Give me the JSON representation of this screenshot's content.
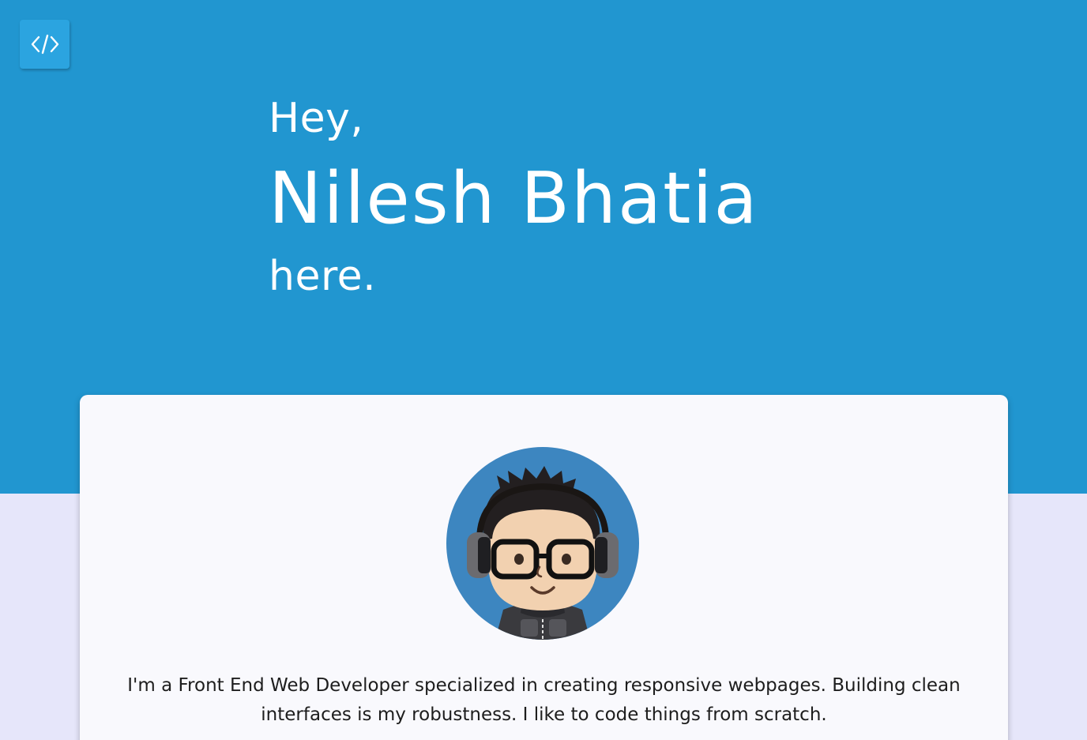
{
  "header": {
    "logo_icon": "code-brackets-icon"
  },
  "hero": {
    "greeting": "Hey,",
    "name": "Nilesh Bhatia",
    "suffix": "here."
  },
  "about": {
    "avatar_icon": "developer-avatar-illustration",
    "bio": "I'm a Front End Web Developer specialized in creating responsive webpages. Building clean interfaces is my robustness. I like to code things from scratch."
  },
  "colors": {
    "hero_background": "#2196d0",
    "page_background": "#e6e6fa",
    "card_background": "#f9f9fd",
    "logo_button": "#2ba4e0",
    "avatar_background": "#3d86c0"
  }
}
